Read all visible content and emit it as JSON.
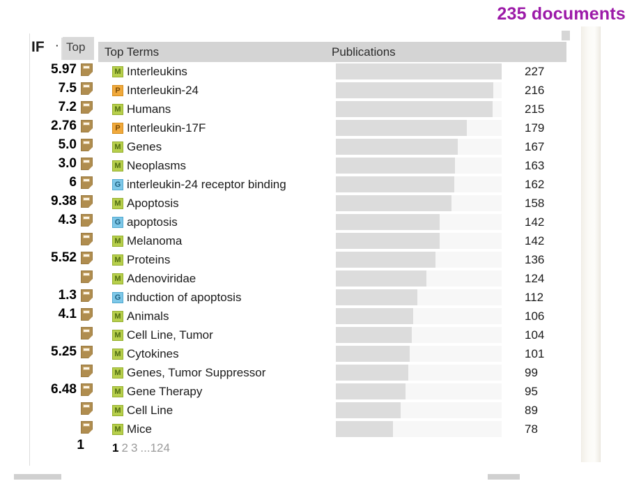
{
  "doc_count_label": "235 documents",
  "accent_color": "#9c1aa8",
  "if_panel": {
    "header_label": "IF",
    "sort_mark": "·",
    "hidden_tab_label": "Top",
    "page_number": "1",
    "values": [
      "5.97",
      "7.5",
      "7.2",
      "2.76",
      "5.0",
      "3.0",
      "6",
      "9.38",
      "4.3",
      "",
      "5.52",
      "",
      "1.3",
      "4.1",
      "",
      "5.25",
      "",
      "6.48",
      "",
      ""
    ],
    "doc_icon_name": "document-icon"
  },
  "table": {
    "columns": [
      "Top Terms",
      "Publications"
    ],
    "max_value": 227,
    "rows": [
      {
        "badge": "M",
        "term": "Interleukins",
        "count": 227
      },
      {
        "badge": "P",
        "term": "Interleukin-24",
        "count": 216
      },
      {
        "badge": "M",
        "term": "Humans",
        "count": 215
      },
      {
        "badge": "P",
        "term": "Interleukin-17F",
        "count": 179
      },
      {
        "badge": "M",
        "term": "Genes",
        "count": 167
      },
      {
        "badge": "M",
        "term": "Neoplasms",
        "count": 163
      },
      {
        "badge": "G",
        "term": "interleukin-24 receptor binding",
        "count": 162
      },
      {
        "badge": "M",
        "term": "Apoptosis",
        "count": 158
      },
      {
        "badge": "G",
        "term": "apoptosis",
        "count": 142
      },
      {
        "badge": "M",
        "term": "Melanoma",
        "count": 142
      },
      {
        "badge": "M",
        "term": "Proteins",
        "count": 136
      },
      {
        "badge": "M",
        "term": "Adenoviridae",
        "count": 124
      },
      {
        "badge": "G",
        "term": "induction of apoptosis",
        "count": 112
      },
      {
        "badge": "M",
        "term": "Animals",
        "count": 106
      },
      {
        "badge": "M",
        "term": "Cell Line, Tumor",
        "count": 104
      },
      {
        "badge": "M",
        "term": "Cytokines",
        "count": 101
      },
      {
        "badge": "M",
        "term": "Genes, Tumor Suppressor",
        "count": 99
      },
      {
        "badge": "M",
        "term": "Gene Therapy",
        "count": 95
      },
      {
        "badge": "M",
        "term": "Cell Line",
        "count": 89
      },
      {
        "badge": "M",
        "term": "Mice",
        "count": 78
      }
    ]
  },
  "pagination": {
    "pages": [
      "1",
      "2",
      "3",
      "...",
      "1",
      "2",
      "4"
    ],
    "current": "1",
    "display": [
      "1",
      "2",
      "3",
      "...1",
      "2",
      "4"
    ]
  },
  "pagination_tokens": [
    {
      "label": "1",
      "current": true
    },
    {
      "label": "2",
      "current": false
    },
    {
      "label": "3",
      "current": false
    },
    {
      "label": "...124",
      "current": false
    }
  ],
  "chart_data": {
    "type": "bar",
    "title": "Top Terms",
    "xlabel": "Publications",
    "ylabel": "",
    "categories": [
      "Interleukins",
      "Interleukin-24",
      "Humans",
      "Interleukin-17F",
      "Genes",
      "Neoplasms",
      "interleukin-24 receptor binding",
      "Apoptosis",
      "apoptosis",
      "Melanoma",
      "Proteins",
      "Adenoviridae",
      "induction of apoptosis",
      "Animals",
      "Cell Line, Tumor",
      "Cytokines",
      "Genes, Tumor Suppressor",
      "Gene Therapy",
      "Cell Line",
      "Mice"
    ],
    "values": [
      227,
      216,
      215,
      179,
      167,
      163,
      162,
      158,
      142,
      142,
      136,
      124,
      112,
      106,
      104,
      101,
      99,
      95,
      89,
      78
    ],
    "xlim": [
      0,
      227
    ],
    "grid": false,
    "legend": "none",
    "orientation": "horizontal",
    "bar_color": "#dcdcdc",
    "track_color": "#f7f7f7"
  }
}
